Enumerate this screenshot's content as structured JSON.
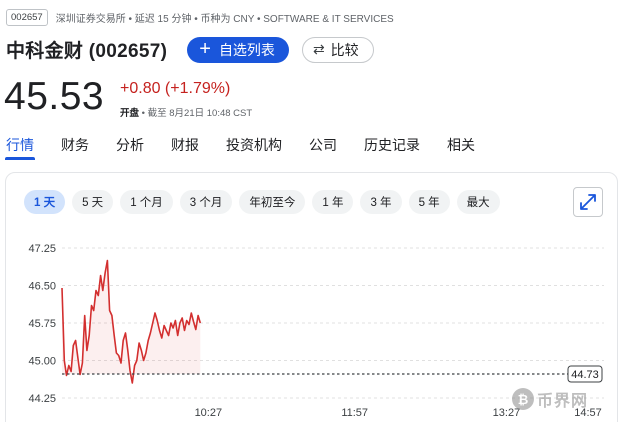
{
  "header": {
    "ticker_badge": "002657",
    "exchange_info": "深圳证券交易所 • 延迟 15 分钟 • 币种为 CNY • SOFTWARE & IT SERVICES",
    "company_name": "中科金财 (002657)",
    "watch_button_label": "自选列表",
    "compare_button_label": "比较"
  },
  "quote": {
    "price": "45.53",
    "change": "+0.80 (+1.79%)",
    "market_status": "开盘",
    "as_of": " • 截至 8月21日 10:48 CST"
  },
  "tabs": [
    {
      "label": "行情",
      "active": true
    },
    {
      "label": "财务",
      "active": false
    },
    {
      "label": "分析",
      "active": false
    },
    {
      "label": "财报",
      "active": false
    },
    {
      "label": "投资机构",
      "active": false
    },
    {
      "label": "公司",
      "active": false
    },
    {
      "label": "历史记录",
      "active": false
    },
    {
      "label": "相关",
      "active": false
    }
  ],
  "ranges": [
    {
      "label": "1 天",
      "active": true
    },
    {
      "label": "5 天",
      "active": false
    },
    {
      "label": "1 个月",
      "active": false
    },
    {
      "label": "3 个月",
      "active": false
    },
    {
      "label": "年初至今",
      "active": false
    },
    {
      "label": "1 年",
      "active": false
    },
    {
      "label": "3 年",
      "active": false
    },
    {
      "label": "5 年",
      "active": false
    },
    {
      "label": "最大",
      "active": false
    }
  ],
  "colors": {
    "accent": "#1a56db",
    "down_line": "#d32f2f",
    "change_text": "#c5221f"
  },
  "watermark_text": "币界网",
  "chart_data": {
    "type": "line",
    "yticks": [
      47.25,
      46.5,
      45.75,
      45.0,
      44.25
    ],
    "ytick_labels": [
      "47.25",
      "46.50",
      "45.75",
      "45.00",
      "44.25"
    ],
    "ylim": [
      44.25,
      47.25
    ],
    "xtick_labels": [
      "10:27",
      "11:57",
      "13:27",
      "14:57"
    ],
    "session_points": 240,
    "previous_close": 44.73,
    "previous_close_label": "44.73",
    "values": [
      46.45,
      45.0,
      44.7,
      44.9,
      44.78,
      45.3,
      45.4,
      45.05,
      44.72,
      44.95,
      45.9,
      45.2,
      45.5,
      46.1,
      46.0,
      46.4,
      46.3,
      46.7,
      46.4,
      46.75,
      47.0,
      46.0,
      45.9,
      45.5,
      45.15,
      45.1,
      44.95,
      45.4,
      45.55,
      45.2,
      44.8,
      44.55,
      44.9,
      45.0,
      45.35,
      45.2,
      45.0,
      45.15,
      45.4,
      45.55,
      45.75,
      45.95,
      45.8,
      45.6,
      45.45,
      45.7,
      45.6,
      45.5,
      45.75,
      45.65,
      45.8,
      45.5,
      45.75,
      45.85,
      45.6,
      45.8,
      45.72,
      45.95,
      45.78,
      45.62,
      45.9,
      45.75
    ]
  }
}
